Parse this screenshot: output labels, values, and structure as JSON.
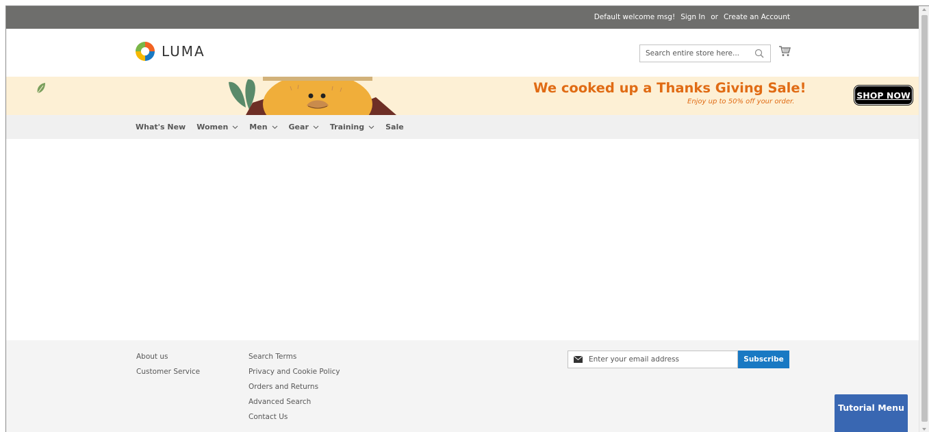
{
  "topbar": {
    "welcome": "Default welcome msg!",
    "sign_in": "Sign In",
    "or": "or",
    "create_account": "Create an Account"
  },
  "header": {
    "logo_text": "LUMA",
    "search_placeholder": "Search entire store here...",
    "cart_icon": "cart-icon",
    "search_icon": "search-icon"
  },
  "banner": {
    "headline": "We cooked up a Thanks Giving Sale!",
    "subline": "Enjoy up to 50% off your order.",
    "cta": "SHOP NOW",
    "colors": {
      "background": "#fdf0d5",
      "headline": "#e06b14",
      "cta_bg": "#000000"
    }
  },
  "nav": {
    "items": [
      {
        "label": "What's New",
        "has_dropdown": false
      },
      {
        "label": "Women",
        "has_dropdown": true
      },
      {
        "label": "Men",
        "has_dropdown": true
      },
      {
        "label": "Gear",
        "has_dropdown": true
      },
      {
        "label": "Training",
        "has_dropdown": true
      },
      {
        "label": "Sale",
        "has_dropdown": false
      }
    ]
  },
  "footer": {
    "col1": [
      "About us",
      "Customer Service"
    ],
    "col2": [
      "Search Terms",
      "Privacy and Cookie Policy",
      "Orders and Returns",
      "Advanced Search",
      "Contact Us"
    ],
    "newsletter_placeholder": "Enter your email address",
    "subscribe": "Subscribe",
    "colors": {
      "subscribe": "#1979c3"
    }
  },
  "tutorial_menu": "Tutorial Menu"
}
